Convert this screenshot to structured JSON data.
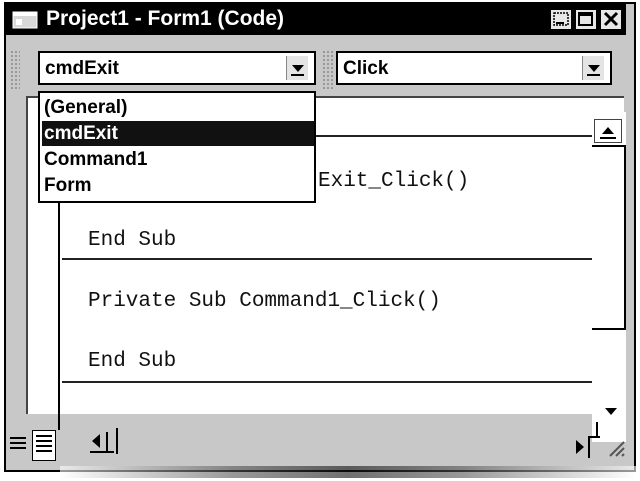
{
  "window": {
    "title": "Project1 - Form1 (Code)",
    "icon": "vb-form-icon",
    "controls": [
      "minimize-icon",
      "maximize-icon",
      "close-icon"
    ]
  },
  "object_combo": {
    "selected": "cmdExit"
  },
  "procedure_combo": {
    "selected": "Click"
  },
  "object_dropdown": {
    "items": [
      "(General)",
      "cmdExit",
      "Command1",
      "Form"
    ],
    "selected_index": 1
  },
  "code": {
    "lines": [
      "Exit_Click()",
      "End Sub",
      "Private Sub Command1_Click()",
      "End Sub"
    ]
  },
  "bottom": {
    "view_buttons": [
      "procedure-view-icon",
      "full-module-view-icon"
    ]
  },
  "colors": {
    "titlebar": "#000000",
    "window_face": "#c8c8c8",
    "selection": "#111111"
  }
}
